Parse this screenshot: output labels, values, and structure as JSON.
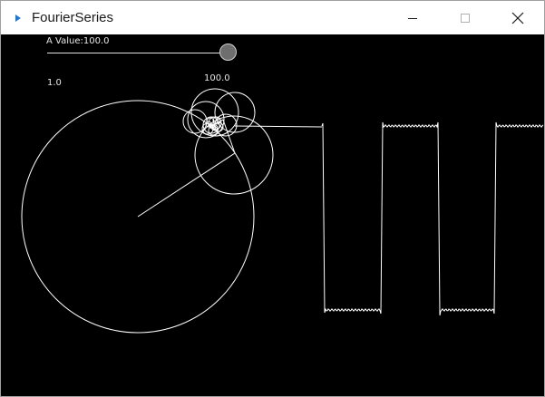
{
  "window": {
    "title": "FourierSeries",
    "minimize_icon": "minimize-icon",
    "maximize_icon": "maximize-icon",
    "close_icon": "close-icon",
    "app_icon": "play-triangle-icon",
    "accent": "#1e78d6"
  },
  "controls": {
    "slider_label": "A Value:100.0",
    "slider_value_fraction": 1.0
  },
  "canvas": {
    "amplitude_label": "1.0",
    "terms_label": "100.0",
    "background": "#000000",
    "stroke": "#ffffff"
  }
}
